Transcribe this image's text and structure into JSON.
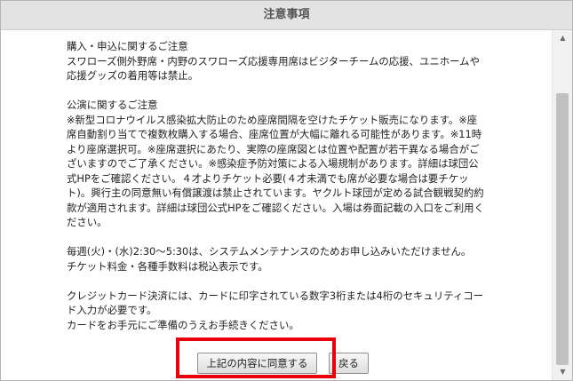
{
  "dialog": {
    "title": "注意事項"
  },
  "notice": {
    "section1": {
      "heading": "購入・申込に関するご注意",
      "lines": [
        "スワローズ側外野席・内野のスワローズ応援専用席はビジターチームの応援、ユニホームや",
        "応援グッズの着用等は禁止。"
      ]
    },
    "section2": {
      "heading": "公演に関するご注意",
      "lines": [
        "※新型コロナウイルス感染拡大防止のため座席間隔を空けたチケット販売になります。※座",
        "席自動割り当てで複数枚購入する場合、座席位置が大幅に離れる可能性があります。※11時",
        "より座席選択可。※座席選択にあたり、実際の座席図とは位置や配置が若干異なる場合がご",
        "ざいますのでご了承ください。※感染症予防対策による入場規制があります。詳細は球団公",
        "式HPをご確認ください。４才よりチケット必要(４才未満でも席が必要な場合は要チケッ",
        "ト)。興行主の同意無い有償譲渡は禁止されています。ヤクルト球団が定める試合観戦契約約",
        "款が適用されます。詳細は球団公式HPをご確認ください。入場は券面記載の入口をご利用く",
        "ださい。"
      ]
    },
    "section3": {
      "lines": [
        "毎週(火)・(水)2:30〜5:30は、システムメンテナンスのためお申し込みいただけません。",
        "チケット料金・各種手数料は税込表示です。"
      ]
    },
    "section4": {
      "lines": [
        "クレジットカード決済には、カードに印字されている数字3桁または4桁のセキュリティコー",
        "ド入力が必要です。",
        "カードをお手元にご準備のうえお手続きください。"
      ]
    }
  },
  "buttons": {
    "agree_label": "上記の内容に同意する",
    "back_label": "戻る"
  },
  "scrollbar": {
    "up_arrow": "▲",
    "down_arrow": "▼"
  },
  "colors": {
    "highlight": "#e8000a",
    "titlebar_bg": "#e3e3e3"
  }
}
